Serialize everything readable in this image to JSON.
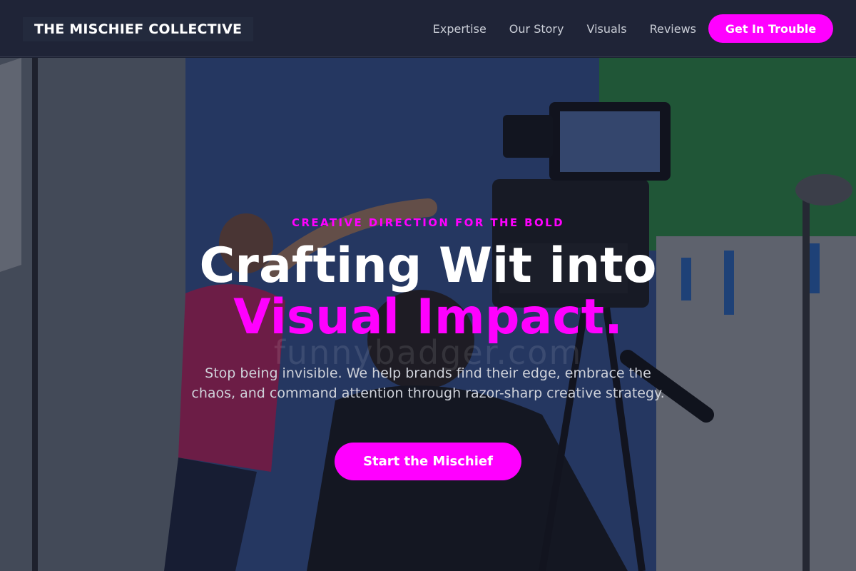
{
  "navbar": {
    "brand": "THE MISCHIEF COLLECTIVE",
    "links": [
      "Expertise",
      "Our Story",
      "Visuals",
      "Reviews"
    ],
    "cta_label": "Get In Trouble"
  },
  "hero": {
    "eyebrow": "CREATIVE DIRECTION FOR THE BOLD",
    "headline_line1": "Crafting Wit into",
    "headline_line2": "Visual Impact.",
    "watermark": "funnybadger.com",
    "subcopy": "Stop being invisible. We help brands find their edge, embrace the chaos, and command attention through razor-sharp creative strategy.",
    "cta_label": "Start the Mischief",
    "background_image": "film-studio-camera-scene"
  },
  "colors": {
    "accent": "#ff00ff",
    "navbar_bg": "#1f2437",
    "headline": "#ffffff",
    "subcopy": "#cfd2da"
  }
}
